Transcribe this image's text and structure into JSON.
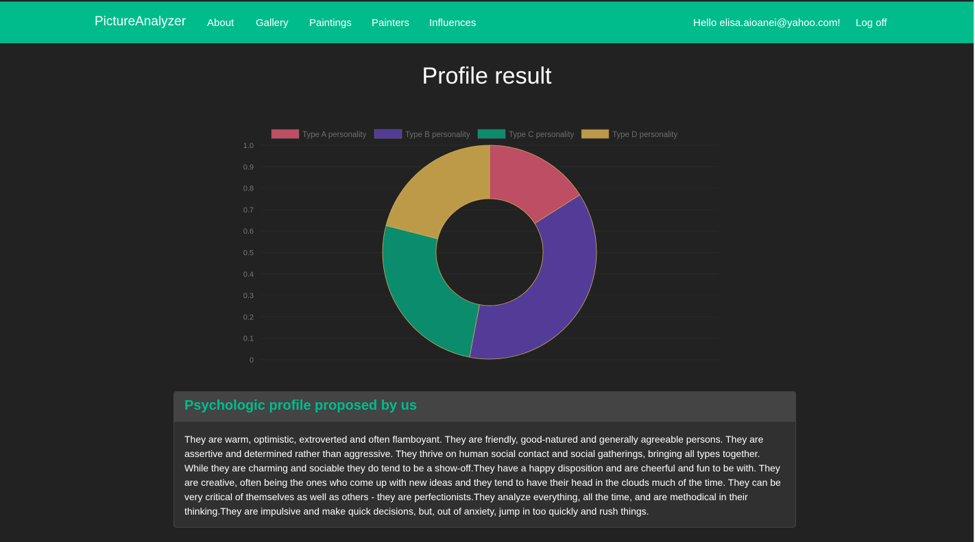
{
  "nav": {
    "brand": "PictureAnalyzer",
    "links": [
      "About",
      "Gallery",
      "Paintings",
      "Painters",
      "Influences"
    ],
    "greeting": "Hello elisa.aioanei@yahoo.com!",
    "logoff": "Log off"
  },
  "page": {
    "title": "Profile result"
  },
  "chart_data": {
    "type": "pie",
    "variant": "doughnut",
    "labels": [
      "Type A personality",
      "Type B personality",
      "Type C personality",
      "Type D personality"
    ],
    "values": [
      16,
      37,
      26,
      21
    ],
    "colors": [
      "#bd4e63",
      "#523c98",
      "#0b8c6d",
      "#bd9a48"
    ],
    "legend_position": "top",
    "yticks": [
      "0",
      "0.1",
      "0.2",
      "0.3",
      "0.4",
      "0.5",
      "0.6",
      "0.7",
      "0.8",
      "0.9",
      "1.0"
    ],
    "ylim": [
      0,
      1
    ],
    "grid": true
  },
  "profile": {
    "heading": "Psychologic profile proposed by us",
    "text": "They are warm, optimistic, extroverted and often flamboyant. They are friendly, good-natured and generally agreeable persons. They are assertive and determined rather than aggressive. They thrive on human social contact and social gatherings, bringing all types together. While they are charming and sociable they do tend to be a show-off.They have a happy disposition and are cheerful and fun to be with. They are creative, often being the ones who come up with new ideas and they tend to have their head in the clouds much of the time. They can be very critical of themselves as well as others - they are perfectionists.They analyze everything, all the time, and are methodical in their thinking.They are impulsive and make quick decisions, but, out of anxiety, jump in too quickly and rush things."
  }
}
